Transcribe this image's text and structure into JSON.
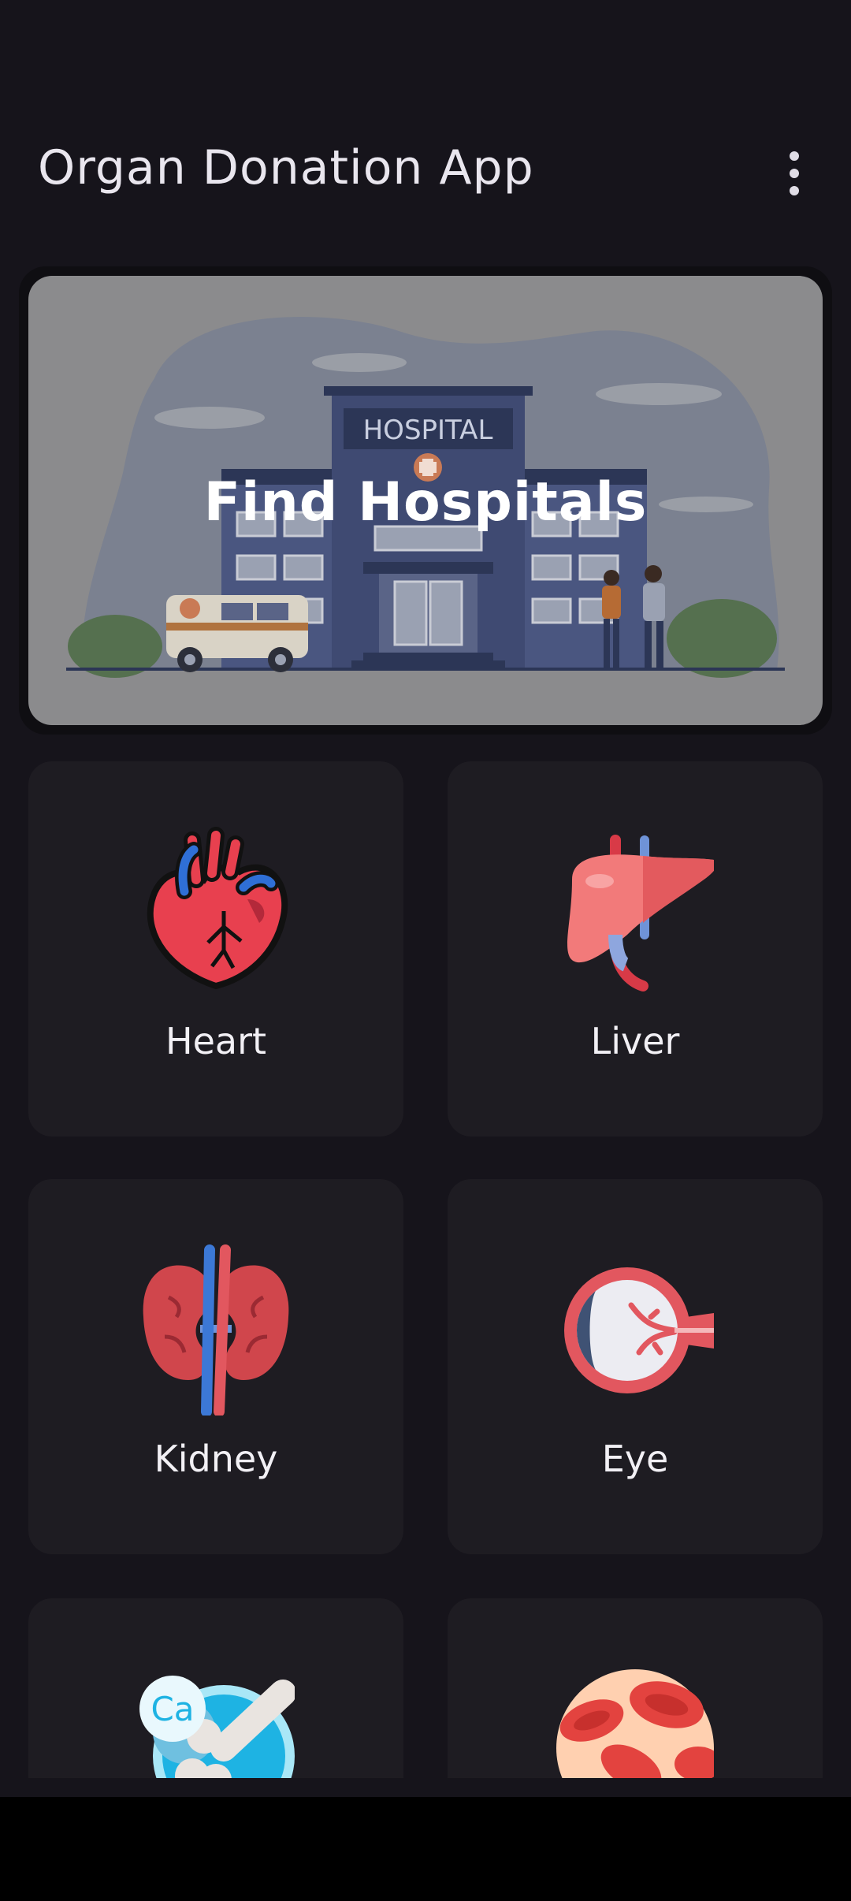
{
  "appbar": {
    "title": "Organ Donation App",
    "menu_icon": "more-vert-icon"
  },
  "hospital_card": {
    "label": "Find Hospitals",
    "sign_text": "HOSPITAL"
  },
  "organs": [
    {
      "label": "Heart",
      "icon": "heart-icon"
    },
    {
      "label": "Liver",
      "icon": "liver-icon"
    },
    {
      "label": "Kidney",
      "icon": "kidney-icon"
    },
    {
      "label": "Eye",
      "icon": "eye-icon"
    },
    {
      "label": "",
      "icon": "bone-icon",
      "badge": "Ca"
    },
    {
      "label": "",
      "icon": "blood-cells-icon"
    }
  ],
  "colors": {
    "background": "#16141b",
    "tile": "#1e1c22",
    "hospital_overlay": "#8b8b8d"
  }
}
